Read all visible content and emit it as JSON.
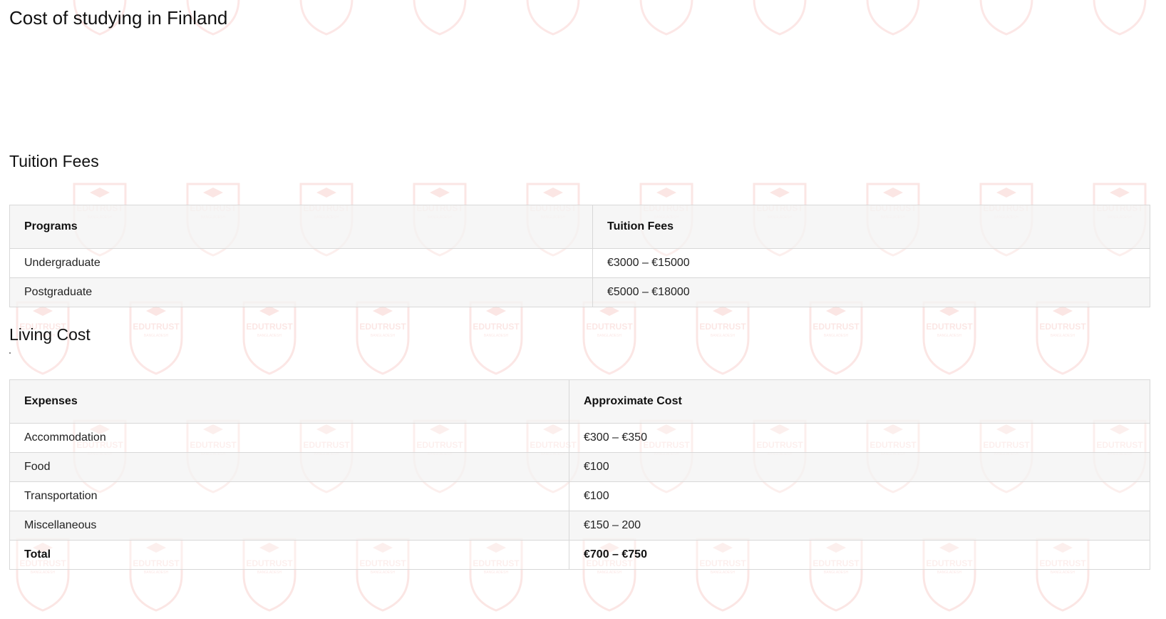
{
  "page": {
    "title": "Cost of studying in Finland"
  },
  "tuition": {
    "heading": "Tuition Fees",
    "columns": [
      "Programs",
      "Tuition Fees"
    ],
    "rows": [
      [
        "Undergraduate",
        "€3000 – €15000"
      ],
      [
        "Postgraduate",
        "€5000 – €18000"
      ]
    ]
  },
  "living": {
    "heading": "Living Cost",
    "columns": [
      "Expenses",
      "Approximate Cost"
    ],
    "rows": [
      [
        "Accommodation",
        "€300 – €350"
      ],
      [
        "Food",
        "€100"
      ],
      [
        "Transportation",
        "€100"
      ],
      [
        "Miscellaneous",
        "€150 – 200"
      ]
    ],
    "total": [
      "Total",
      "€700 – €750"
    ]
  },
  "watermark": {
    "brand": "EDUTRUST",
    "tagline": "BANGLADESH",
    "color": "#e8463a"
  }
}
